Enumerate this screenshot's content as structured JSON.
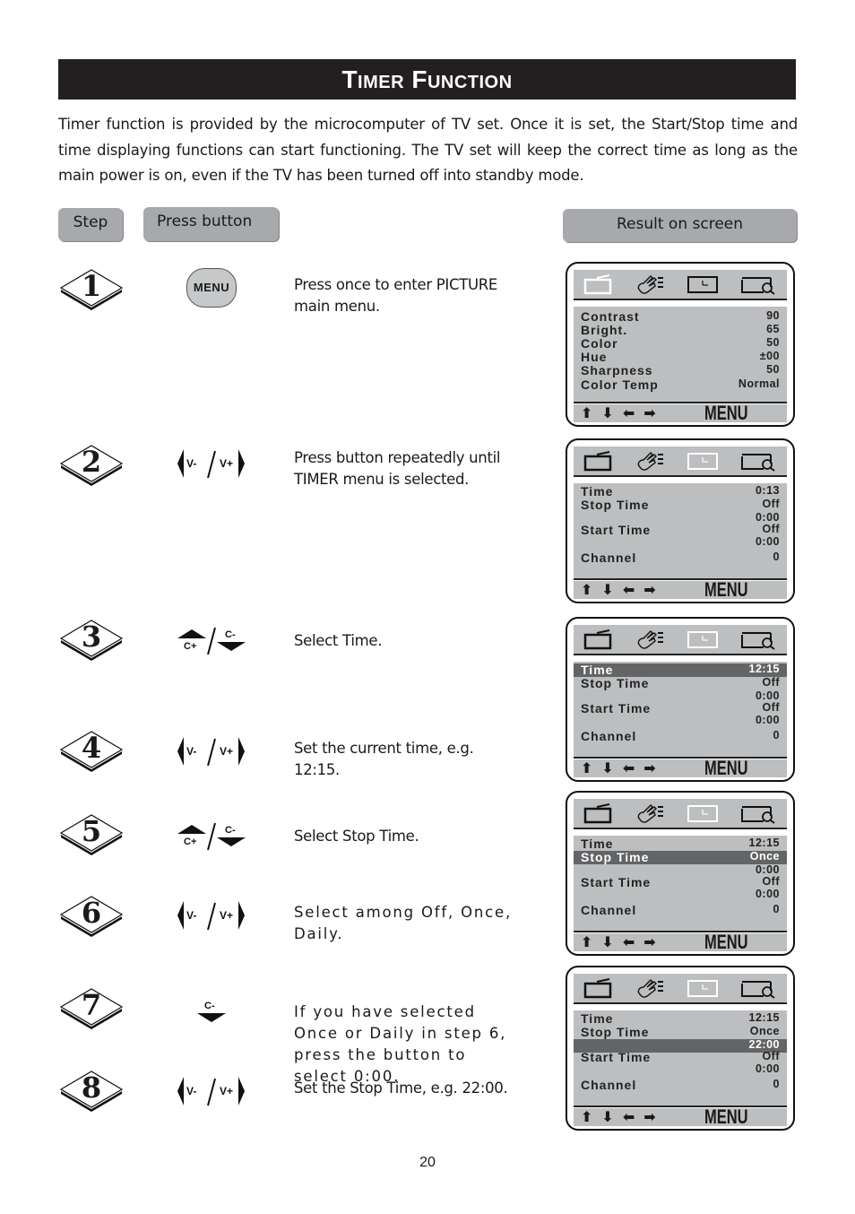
{
  "title": "Timer Function",
  "intro": "Timer function is  provided by the microcomputer of TV set. Once it is set,  the Start/Stop time and time displaying functions can start functioning. The TV set will keep the correct time as long as the main power is on, even if the TV has been turned off into standby mode.",
  "headers": {
    "step": "Step",
    "press_button": "Press  button",
    "result": "Result  on screen"
  },
  "steps": [
    {
      "number": "1",
      "button": "menu-button",
      "button_label": "MENU",
      "description": "Press once to enter PICTURE main menu."
    },
    {
      "number": "2",
      "button": "volume-pair",
      "labels": [
        "V-",
        "V+"
      ],
      "description": "Press button repeatedly until TIMER menu is selected."
    },
    {
      "number": "3",
      "button": "channel-pair",
      "labels": [
        "C+",
        "C-"
      ],
      "description": "Select Time."
    },
    {
      "number": "4",
      "button": "volume-pair",
      "labels": [
        "V-",
        "V+"
      ],
      "description": "Set the current time, e.g. 12:15."
    },
    {
      "number": "5",
      "button": "channel-pair",
      "labels": [
        "C+",
        "C-"
      ],
      "description": "Select Stop Time."
    },
    {
      "number": "6",
      "button": "volume-pair",
      "labels": [
        "V-",
        "V+"
      ],
      "description": "Select among Off, Once, Daily."
    },
    {
      "number": "7",
      "button": "channel-down",
      "labels": [
        "C-"
      ],
      "description": "If you have selected Once or Daily in step 6, press the button to select 0:00."
    },
    {
      "number": "8",
      "button": "volume-pair",
      "labels": [
        "V-",
        "V+"
      ],
      "description": "Set the Stop Time, e.g. 22:00."
    }
  ],
  "osd_footer": {
    "arrows": "⬆⬇⬅➡",
    "menu": "MENU"
  },
  "osd_icons": [
    "picture-tab-icon",
    "feature-tab-icon",
    "timer-clock-tab-icon",
    "search-tab-icon"
  ],
  "screens": [
    {
      "active_tab": "picture",
      "rows": [
        {
          "label": "Contrast",
          "value": "90"
        },
        {
          "label": "Bright.",
          "value": "65"
        },
        {
          "label": "Color",
          "value": "50"
        },
        {
          "label": "Hue",
          "value": "±00"
        },
        {
          "label": "Sharpness",
          "value": "50"
        },
        {
          "label": "Color Temp",
          "value": "Normal"
        }
      ]
    },
    {
      "active_tab": "timer",
      "rows": [
        {
          "label": "Time",
          "value": "0:13"
        },
        {
          "label": "Stop Time",
          "value": "Off"
        },
        {
          "label": "",
          "value": "0:00"
        },
        {
          "label": "Start Time",
          "value": "Off"
        },
        {
          "label": "",
          "value": "0:00"
        },
        {
          "label": "Channel",
          "value": "0"
        }
      ]
    },
    {
      "active_tab": "timer",
      "selected_row": 0,
      "rows": [
        {
          "label": "Time",
          "value": "12:15"
        },
        {
          "label": "Stop Time",
          "value": "Off"
        },
        {
          "label": "",
          "value": "0:00"
        },
        {
          "label": "Start Time",
          "value": "Off"
        },
        {
          "label": "",
          "value": "0:00"
        },
        {
          "label": "Channel",
          "value": "0"
        }
      ]
    },
    {
      "active_tab": "timer",
      "selected_row": 1,
      "rows": [
        {
          "label": "Time",
          "value": "12:15"
        },
        {
          "label": "Stop Time",
          "value": "Once"
        },
        {
          "label": "",
          "value": "0:00"
        },
        {
          "label": "Start Time",
          "value": "Off"
        },
        {
          "label": "",
          "value": "0:00"
        },
        {
          "label": "Channel",
          "value": "0"
        }
      ]
    },
    {
      "active_tab": "timer",
      "selected_row": 2,
      "rows": [
        {
          "label": "Time",
          "value": "12:15"
        },
        {
          "label": "Stop Time",
          "value": "Once"
        },
        {
          "label": "",
          "value": "22:00"
        },
        {
          "label": "Start Time",
          "value": "Off"
        },
        {
          "label": "",
          "value": "0:00"
        },
        {
          "label": "Channel",
          "value": "0"
        }
      ]
    }
  ],
  "page_number": "20"
}
